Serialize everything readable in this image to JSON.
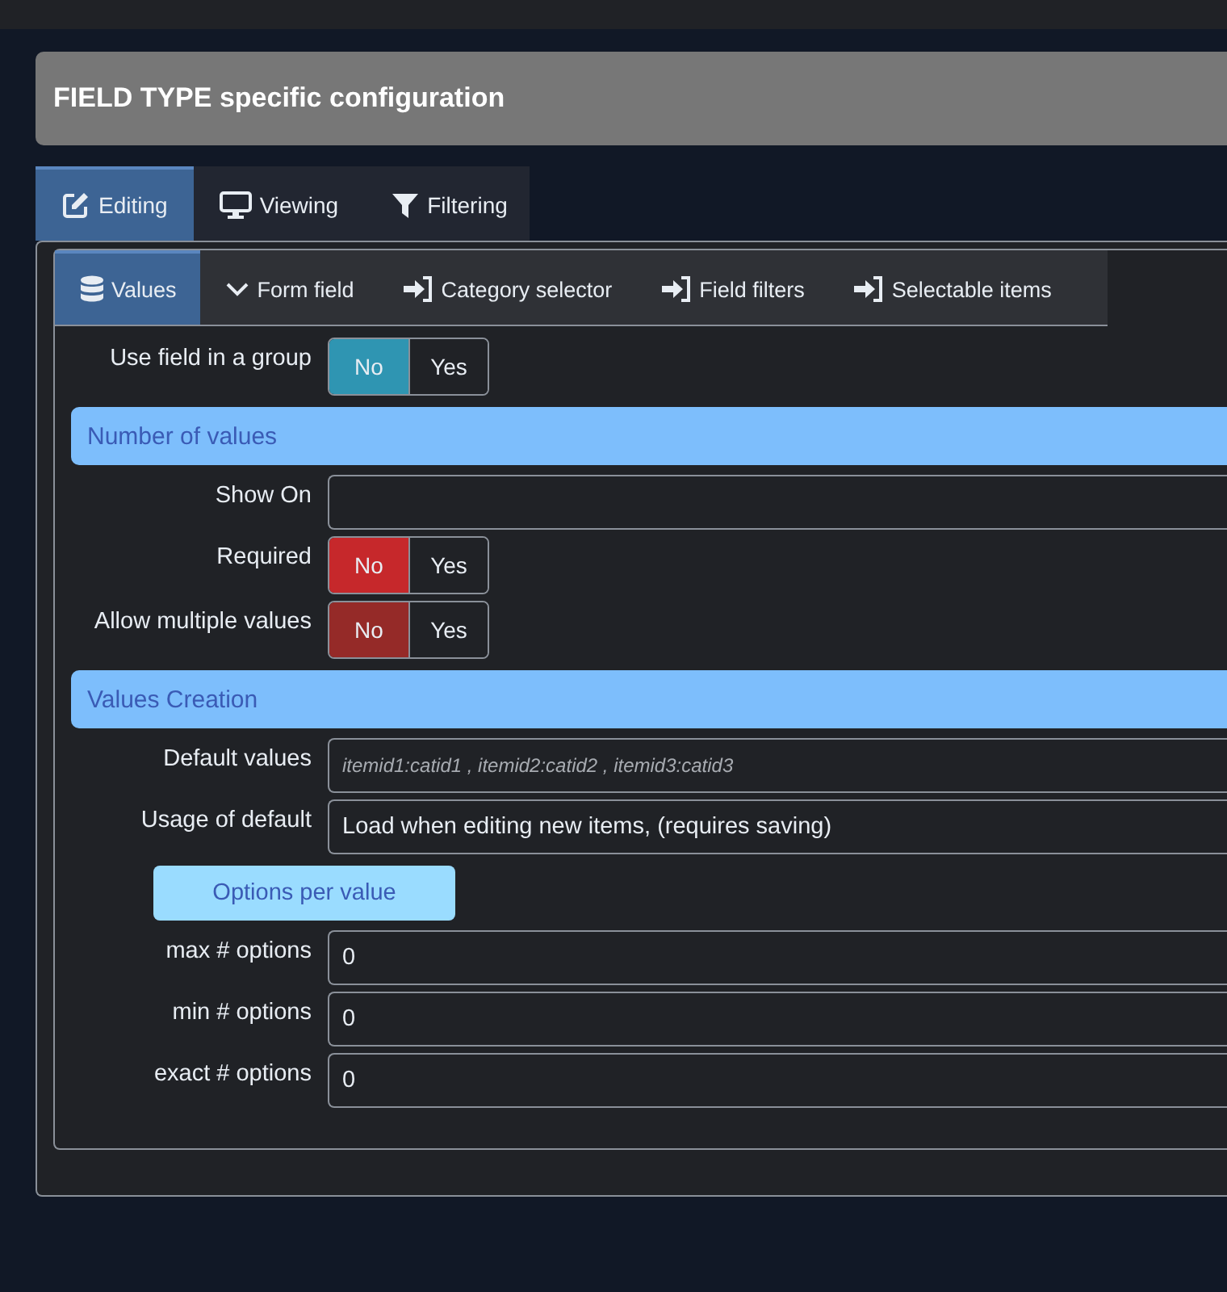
{
  "panel": {
    "title": "FIELD TYPE specific configuration"
  },
  "tabs": [
    {
      "label": "Editing",
      "selected": true
    },
    {
      "label": "Viewing",
      "selected": false
    },
    {
      "label": "Filtering",
      "selected": false
    }
  ],
  "subtabs": [
    {
      "label": "Values",
      "selected": true
    },
    {
      "label": "Form field",
      "selected": false
    },
    {
      "label": "Category selector",
      "selected": false
    },
    {
      "label": "Field filters",
      "selected": false
    },
    {
      "label": "Selectable items",
      "selected": false
    }
  ],
  "rows": [
    {
      "kind": "toggle",
      "label": "Use field in a group",
      "color": "#2f95b2",
      "options": [
        {
          "label": "No",
          "selected": true
        },
        {
          "label": "Yes",
          "selected": false
        }
      ]
    },
    {
      "kind": "section",
      "label": "Number of values"
    },
    {
      "kind": "field",
      "label": "Show On"
    },
    {
      "kind": "toggle",
      "label": "Required",
      "color": "#c6282b",
      "options": [
        {
          "label": "No",
          "selected": true
        },
        {
          "label": "Yes",
          "selected": false
        }
      ]
    },
    {
      "kind": "toggle",
      "label": "Allow multiple values",
      "color": "#952a28",
      "options": [
        {
          "label": "No",
          "selected": true
        },
        {
          "label": "Yes",
          "selected": false
        }
      ]
    },
    {
      "kind": "section",
      "label": "Values Creation"
    },
    {
      "kind": "field",
      "label": "Default values",
      "placeholder": "itemid1:catid1 , itemid2:catid2 , itemid3:catid3"
    },
    {
      "kind": "select",
      "label": "Usage of default",
      "value": "Load when editing new items, (requires saving)"
    },
    {
      "kind": "button",
      "label": "Options per value"
    },
    {
      "kind": "field",
      "label": "max # options",
      "value": "0"
    },
    {
      "kind": "field",
      "label": "min # options",
      "value": "0"
    },
    {
      "kind": "field",
      "label": "exact # options",
      "value": "0"
    }
  ]
}
